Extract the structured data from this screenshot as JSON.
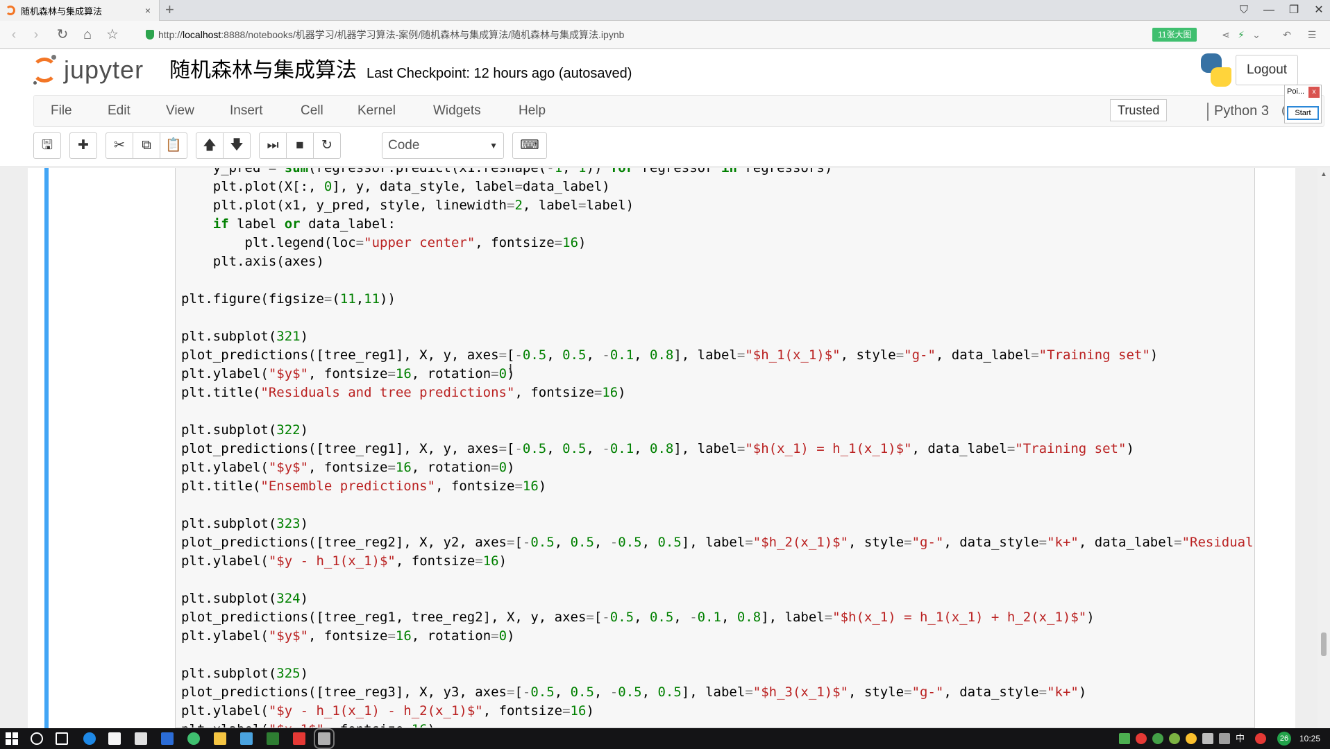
{
  "browser": {
    "tab_title": "随机森林与集成算法",
    "tab_close": "×",
    "new_tab": "+",
    "url_prefix": "http://",
    "url_host": "localhost",
    "url_rest": ":8888/notebooks/机器学习/机器学习算法-案例/随机森林与集成算法/随机森林与集成算法.ipynb",
    "badge": "11张大图",
    "window_min": "—",
    "window_max": "❐",
    "window_close": "✕"
  },
  "jupyter": {
    "logo_text": "jupyter",
    "notebook_name": "随机森林与集成算法",
    "checkpoint": "Last Checkpoint: 12 hours ago (autosaved)",
    "logout": "Logout",
    "popup_title": "Poi...",
    "popup_close": "x",
    "popup_start": "Start",
    "menu": [
      "File",
      "Edit",
      "View",
      "Insert",
      "Cell",
      "Kernel",
      "Widgets",
      "Help"
    ],
    "trusted": "Trusted",
    "kernel": "Python 3",
    "cell_type": "Code"
  },
  "taskbar": {
    "badge_num": "26",
    "ime": "中",
    "clock": "10:25"
  }
}
